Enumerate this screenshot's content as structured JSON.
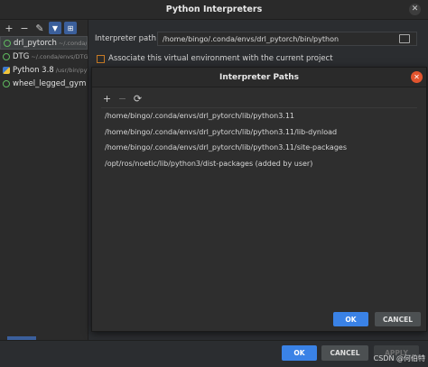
{
  "window": {
    "title": "Python Interpreters"
  },
  "left_panel": {
    "toolbar_icons": [
      "plus-icon",
      "minus-icon",
      "edit-icon",
      "filter-icon",
      "tree-icon"
    ],
    "interpreters": [
      {
        "name": "drl_pytorch",
        "path": "~/.conda/e",
        "icon": "ring-icon",
        "selected": true
      },
      {
        "name": "DTG",
        "path": "~/.conda/envs/DTG",
        "icon": "ring-icon",
        "selected": false
      },
      {
        "name": "Python 3.8",
        "path": "/usr/bin/pyt",
        "icon": "python-icon",
        "selected": false
      },
      {
        "name": "wheel_legged_gym",
        "path": "",
        "icon": "ring-icon",
        "selected": false
      }
    ]
  },
  "settings": {
    "path_label": "Interpreter path:",
    "path_value": "/home/bingo/.conda/envs/drl_pytorch/bin/python",
    "associate_label": "Associate this virtual environment with the current project",
    "associate_checked": false
  },
  "dialog": {
    "title": "Interpreter Paths",
    "paths": [
      "/home/bingo/.conda/envs/drl_pytorch/lib/python3.11",
      "/home/bingo/.conda/envs/drl_pytorch/lib/python3.11/lib-dynload",
      "/home/bingo/.conda/envs/drl_pytorch/lib/python3.11/site-packages",
      "/opt/ros/noetic/lib/python3/dist-packages  (added by user)"
    ],
    "ok_label": "OK",
    "cancel_label": "CANCEL"
  },
  "footer": {
    "ok_label": "OK",
    "cancel_label": "CANCEL",
    "apply_label": "APPLY",
    "watermark": "CSDN @何伯特"
  },
  "colors": {
    "accent": "#3a82e6",
    "dialog_close": "#e2542e",
    "checkbox_border": "#c77a25",
    "env_ring": "#5fb85f"
  }
}
